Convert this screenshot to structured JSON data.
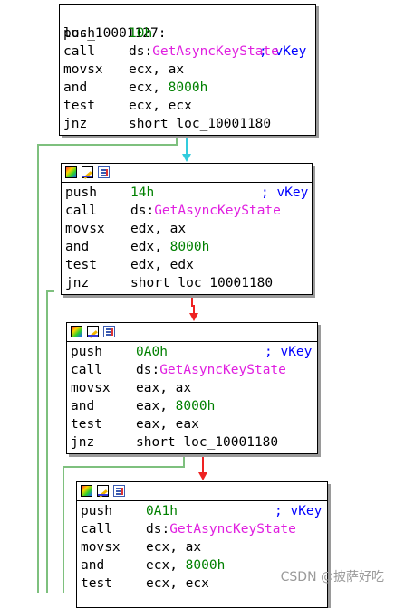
{
  "blocks": [
    {
      "label": "loc_10001127:",
      "comment": "; vKey",
      "lines": [
        {
          "mnemonic": "push",
          "operand_parts": [
            {
              "text": "10h",
              "kind": "imm"
            }
          ]
        },
        {
          "mnemonic": "call",
          "operand_parts": [
            {
              "text": "ds:",
              "kind": "text"
            },
            {
              "text": "GetAsyncKeyState",
              "kind": "fn"
            }
          ]
        },
        {
          "mnemonic": "movsx",
          "operand_parts": [
            {
              "text": "ecx, ax",
              "kind": "text"
            }
          ]
        },
        {
          "mnemonic": "and",
          "operand_parts": [
            {
              "text": "ecx, ",
              "kind": "text"
            },
            {
              "text": "8000h",
              "kind": "imm"
            }
          ]
        },
        {
          "mnemonic": "test",
          "operand_parts": [
            {
              "text": "ecx, ecx",
              "kind": "text"
            }
          ]
        },
        {
          "mnemonic": "jnz",
          "operand_parts": [
            {
              "text": "short loc_10001180",
              "kind": "text"
            }
          ]
        }
      ]
    },
    {
      "header_icons": [
        "graph-icon",
        "edit-icon",
        "list-icon"
      ],
      "lines": [
        {
          "mnemonic": "push",
          "operand_parts": [
            {
              "text": "14h",
              "kind": "imm"
            }
          ],
          "comment": "; vKey"
        },
        {
          "mnemonic": "call",
          "operand_parts": [
            {
              "text": "ds:",
              "kind": "text"
            },
            {
              "text": "GetAsyncKeyState",
              "kind": "fn"
            }
          ]
        },
        {
          "mnemonic": "movsx",
          "operand_parts": [
            {
              "text": "edx, ax",
              "kind": "text"
            }
          ]
        },
        {
          "mnemonic": "and",
          "operand_parts": [
            {
              "text": "edx, ",
              "kind": "text"
            },
            {
              "text": "8000h",
              "kind": "imm"
            }
          ]
        },
        {
          "mnemonic": "test",
          "operand_parts": [
            {
              "text": "edx, edx",
              "kind": "text"
            }
          ]
        },
        {
          "mnemonic": "jnz",
          "operand_parts": [
            {
              "text": "short loc_10001180",
              "kind": "text"
            }
          ]
        }
      ]
    },
    {
      "header_icons": [
        "graph-icon",
        "edit-icon",
        "list-icon"
      ],
      "lines": [
        {
          "mnemonic": "push",
          "operand_parts": [
            {
              "text": "0A0h",
              "kind": "imm"
            }
          ],
          "comment": "; vKey"
        },
        {
          "mnemonic": "call",
          "operand_parts": [
            {
              "text": "ds:",
              "kind": "text"
            },
            {
              "text": "GetAsyncKeyState",
              "kind": "fn"
            }
          ]
        },
        {
          "mnemonic": "movsx",
          "operand_parts": [
            {
              "text": "eax, ax",
              "kind": "text"
            }
          ]
        },
        {
          "mnemonic": "and",
          "operand_parts": [
            {
              "text": "eax, ",
              "kind": "text"
            },
            {
              "text": "8000h",
              "kind": "imm"
            }
          ]
        },
        {
          "mnemonic": "test",
          "operand_parts": [
            {
              "text": "eax, eax",
              "kind": "text"
            }
          ]
        },
        {
          "mnemonic": "jnz",
          "operand_parts": [
            {
              "text": "short loc_10001180",
              "kind": "text"
            }
          ]
        }
      ]
    },
    {
      "header_icons": [
        "graph-icon",
        "edit-icon",
        "list-icon"
      ],
      "lines": [
        {
          "mnemonic": "push",
          "operand_parts": [
            {
              "text": "0A1h",
              "kind": "imm"
            }
          ],
          "comment": "; vKey"
        },
        {
          "mnemonic": "call",
          "operand_parts": [
            {
              "text": "ds:",
              "kind": "text"
            },
            {
              "text": "GetAsyncKeyState",
              "kind": "fn"
            }
          ]
        },
        {
          "mnemonic": "movsx",
          "operand_parts": [
            {
              "text": "ecx, ax",
              "kind": "text"
            }
          ]
        },
        {
          "mnemonic": "and",
          "operand_parts": [
            {
              "text": "ecx, ",
              "kind": "text"
            },
            {
              "text": "8000h",
              "kind": "imm"
            }
          ]
        },
        {
          "mnemonic": "test",
          "operand_parts": [
            {
              "text": "ecx, ecx",
              "kind": "text"
            }
          ]
        }
      ]
    }
  ],
  "watermark": "CSDN @披萨好吃",
  "colors": {
    "immediate": "#008000",
    "function": "#e020e0",
    "comment": "#0000ff",
    "edge_fallthrough": "#33ccdd",
    "edge_false": "#ee2222",
    "edge_true": "#7ec07e"
  }
}
